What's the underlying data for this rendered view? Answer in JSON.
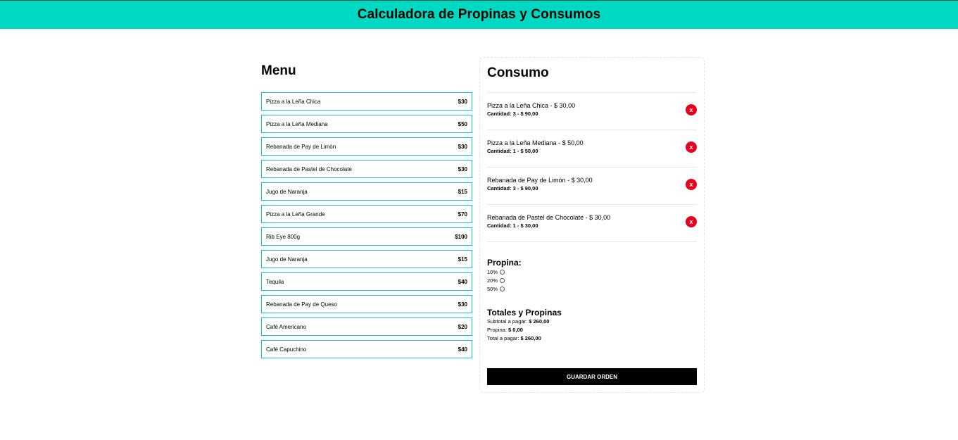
{
  "header": {
    "title": "Calculadora de Propinas y Consumos"
  },
  "colors": {
    "accent": "#00d9c2",
    "menu_border": "#0fc7b2",
    "remove": "#e8001c",
    "button": "#000000"
  },
  "menu": {
    "title": "Menu",
    "items": [
      {
        "name": "Pizza a la Leña Chica",
        "price": "$30"
      },
      {
        "name": "Pizza a la Leña Mediana",
        "price": "$50"
      },
      {
        "name": "Rebanada de Pay de Limón",
        "price": "$30"
      },
      {
        "name": "Rebanada de Pastel de Chocolate",
        "price": "$30"
      },
      {
        "name": "Jugo de Naranja",
        "price": "$15"
      },
      {
        "name": "Pizza a la Leña Grande",
        "price": "$70"
      },
      {
        "name": "Rib Eye 800g",
        "price": "$100"
      },
      {
        "name": "Jugo de Naranja",
        "price": "$15"
      },
      {
        "name": "Tequila",
        "price": "$40"
      },
      {
        "name": "Rebanada de Pay de Queso",
        "price": "$30"
      },
      {
        "name": "Café Americano",
        "price": "$20"
      },
      {
        "name": "Café Capuchino",
        "price": "$40"
      }
    ]
  },
  "consumo": {
    "title": "Consumo",
    "orders": [
      {
        "line1": "Pizza a la Leña Chica - $ 30,00",
        "line2": "Cantidad: 3 - $ 90,00",
        "remove": "x"
      },
      {
        "line1": "Pizza a la Leña Mediana - $ 50,00",
        "line2": "Cantidad: 1 - $ 50,00",
        "remove": "x"
      },
      {
        "line1": "Rebanada de Pay de Limón - $ 30,00",
        "line2": "Cantidad: 3 - $ 90,00",
        "remove": "x"
      },
      {
        "line1": "Rebanada de Pastel de Chocolate - $ 30,00",
        "line2": "Cantidad: 1 - $ 30,00",
        "remove": "x"
      }
    ],
    "tip": {
      "title": "Propina:",
      "options": [
        "10%",
        "20%",
        "50%"
      ],
      "selected": null
    },
    "totals": {
      "title": "Totales y Propinas",
      "subtotal_label": "Subtotal a pagar:",
      "subtotal_value": "$ 260,00",
      "tip_label": "Propina:",
      "tip_value": "$ 0,00",
      "total_label": "Total a pagar:",
      "total_value": "$ 260,00"
    },
    "save_label": "GUARDAR ORDEN"
  }
}
